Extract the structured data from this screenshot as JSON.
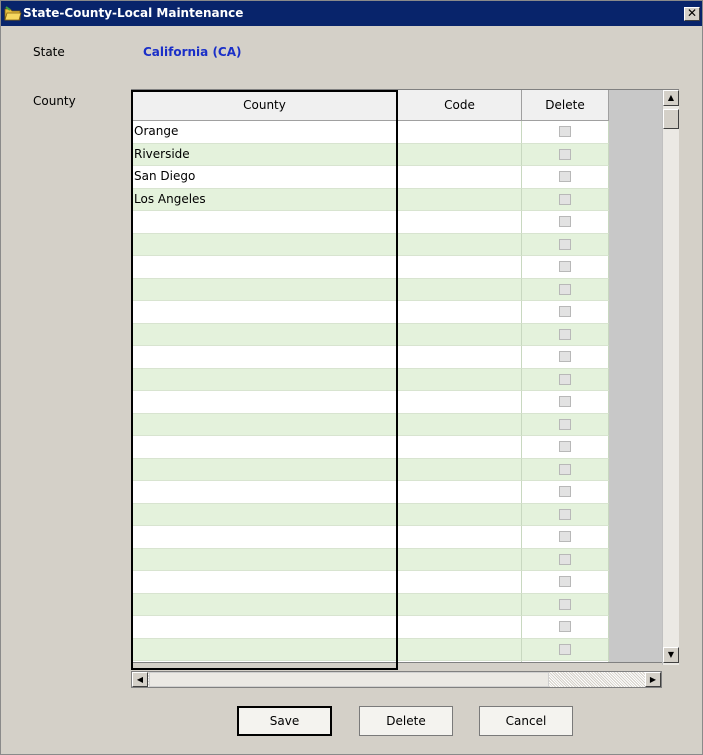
{
  "window": {
    "title": "State-County-Local Maintenance",
    "close_glyph": "✕",
    "icon": "folder-icon"
  },
  "form": {
    "state_label": "State",
    "state_value": "California (CA)",
    "county_label": "County"
  },
  "grid": {
    "columns": [
      "County",
      "Code",
      "Delete"
    ],
    "rows": [
      {
        "county": "Orange",
        "code": "",
        "delete": false
      },
      {
        "county": "Riverside",
        "code": "",
        "delete": false
      },
      {
        "county": "San Diego",
        "code": "",
        "delete": false
      },
      {
        "county": "Los Angeles",
        "code": "",
        "delete": false
      },
      {
        "county": "",
        "code": "",
        "delete": false
      },
      {
        "county": "",
        "code": "",
        "delete": false
      },
      {
        "county": "",
        "code": "",
        "delete": false
      },
      {
        "county": "",
        "code": "",
        "delete": false
      },
      {
        "county": "",
        "code": "",
        "delete": false
      },
      {
        "county": "",
        "code": "",
        "delete": false
      },
      {
        "county": "",
        "code": "",
        "delete": false
      },
      {
        "county": "",
        "code": "",
        "delete": false
      },
      {
        "county": "",
        "code": "",
        "delete": false
      },
      {
        "county": "",
        "code": "",
        "delete": false
      },
      {
        "county": "",
        "code": "",
        "delete": false
      },
      {
        "county": "",
        "code": "",
        "delete": false
      },
      {
        "county": "",
        "code": "",
        "delete": false
      },
      {
        "county": "",
        "code": "",
        "delete": false
      },
      {
        "county": "",
        "code": "",
        "delete": false
      },
      {
        "county": "",
        "code": "",
        "delete": false
      },
      {
        "county": "",
        "code": "",
        "delete": false
      },
      {
        "county": "",
        "code": "",
        "delete": false
      },
      {
        "county": "",
        "code": "",
        "delete": false
      },
      {
        "county": "",
        "code": "",
        "delete": false
      },
      {
        "county": "",
        "code": "",
        "delete": false
      }
    ]
  },
  "scrollbars": {
    "up_glyph": "▲",
    "down_glyph": "▼",
    "left_glyph": "◀",
    "right_glyph": "▶"
  },
  "buttons": {
    "save": "Save",
    "delete": "Delete",
    "cancel": "Cancel"
  },
  "colors": {
    "titlebar": "#08246b",
    "state_value": "#1a2fc8",
    "row_alt": "#e4f2dc",
    "dialog_bg": "#d4d0c8"
  }
}
